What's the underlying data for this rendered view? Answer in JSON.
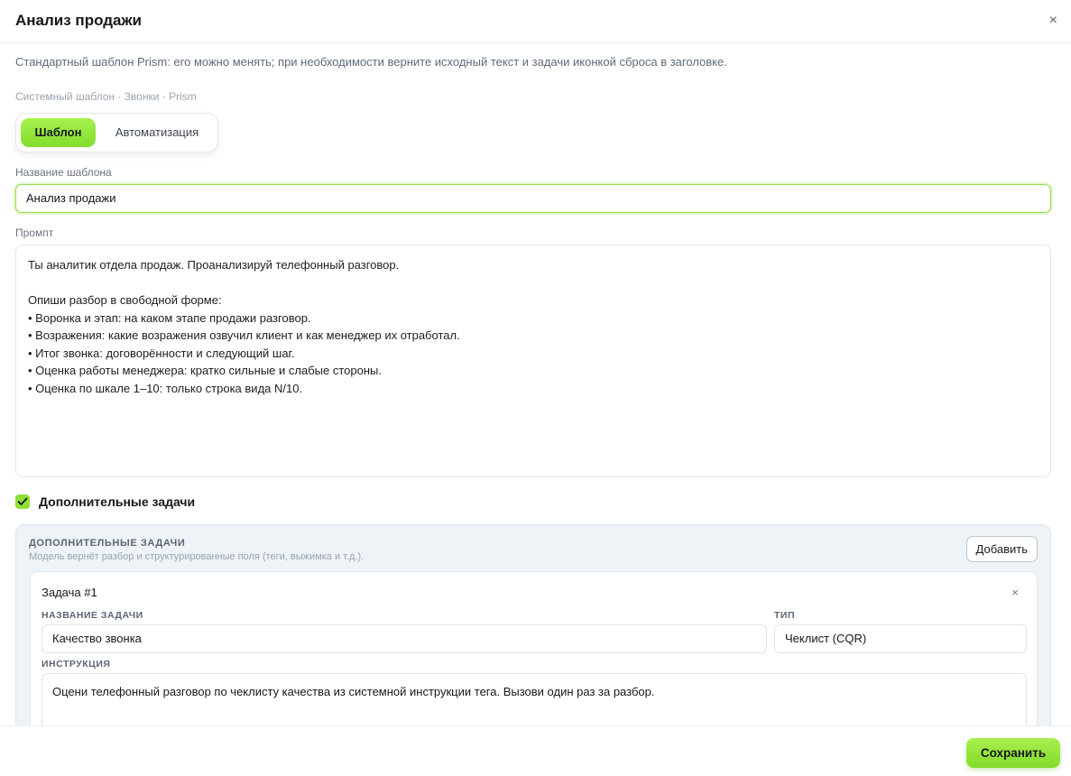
{
  "header": {
    "title": "Анализ продажи",
    "close_icon": "×"
  },
  "info_text": "Стандартный шаблон Prism: его можно менять; при необходимости верните исходный текст и задачи иконкой сброса в заголовке.",
  "meta_text": "Системный шаблон · Звонки · Prism",
  "tabs": [
    {
      "label": "Шаблон",
      "active": true
    },
    {
      "label": "Автоматизация",
      "active": false
    }
  ],
  "name_field": {
    "label": "Название шаблона",
    "value": "Анализ продажи"
  },
  "prompt_field": {
    "label": "Промпт",
    "lines": [
      "Ты аналитик отдела продаж. Проанализируй телефонный разговор.",
      "",
      "Опиши разбор в свободной форме:",
      "• Воронка и этап: на каком этапе продажи разговор.",
      "• Возражения: какие возражения озвучил клиент и как менеджер их отработал.",
      "• Итог звонка: договорённости и следующий шаг.",
      "• Оценка работы менеджера: кратко сильные и слабые стороны.",
      "• Оценка по шкале 1–10: только строка вида N/10."
    ]
  },
  "extra_tasks_toggle": {
    "label": "Дополнительные задачи",
    "checked": true
  },
  "tasks_panel": {
    "title": "ДОПОЛНИТЕЛЬНЫЕ ЗАДАЧИ",
    "subtitle": "Модель вернёт разбор и структурированные поля (теги, выжимка и т.д.).",
    "add_label": "Добавить",
    "task": {
      "heading": "Задача #1",
      "close_icon": "×",
      "name_label": "НАЗВАНИЕ ЗАДАЧИ",
      "name_value": "Качество звонка",
      "type_label": "ТИП",
      "type_value": "Чеклист (CQR)",
      "instruction_label": "ИНСТРУКЦИЯ",
      "instruction_value": "Оцени телефонный разговор по чеклисту качества из системной инструкции тега. Вызови один раз за разбор."
    }
  },
  "footer": {
    "save_label": "Сохранить"
  },
  "colors": {
    "accent": "#8fdf36",
    "accent_dark": "#82dc2a",
    "panel_bg": "#eef3f8"
  }
}
